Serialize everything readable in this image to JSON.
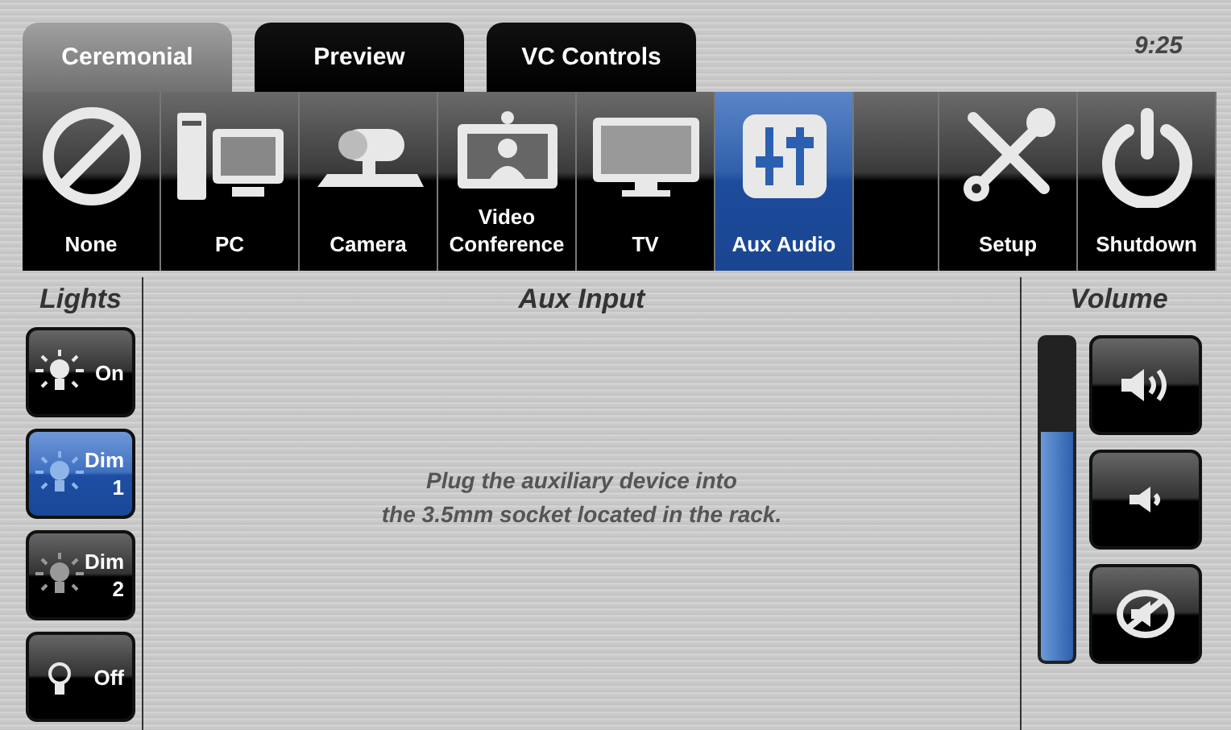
{
  "tabs": [
    {
      "label": "Ceremonial",
      "selected": true
    },
    {
      "label": "Preview",
      "selected": false
    },
    {
      "label": "VC Controls",
      "selected": false
    }
  ],
  "clock": "9:25",
  "sources": [
    {
      "kind": "none",
      "label": "None",
      "selected": false
    },
    {
      "kind": "pc",
      "label": "PC",
      "selected": false
    },
    {
      "kind": "camera",
      "label": "Camera",
      "selected": false
    },
    {
      "kind": "vc",
      "label": "Video Conference",
      "selected": false
    },
    {
      "kind": "tv",
      "label": "TV",
      "selected": false
    },
    {
      "kind": "aux",
      "label": "Aux Audio",
      "selected": true
    }
  ],
  "system": [
    {
      "kind": "setup",
      "label": "Setup"
    },
    {
      "kind": "power",
      "label": "Shutdown"
    }
  ],
  "lights": {
    "title": "Lights",
    "buttons": [
      {
        "kind": "on",
        "label": "On",
        "selected": false
      },
      {
        "kind": "dim",
        "label": "Dim",
        "sub": "1",
        "selected": true
      },
      {
        "kind": "dim",
        "label": "Dim",
        "sub": "2",
        "selected": false
      },
      {
        "kind": "off",
        "label": "Off",
        "selected": false
      }
    ]
  },
  "content": {
    "title": "Aux Input",
    "message": [
      "Plug the auxiliary device into",
      "the 3.5mm socket located in the rack."
    ]
  },
  "volume": {
    "title": "Volume",
    "level": 0.71,
    "buttons": [
      {
        "kind": "up"
      },
      {
        "kind": "down"
      },
      {
        "kind": "mute"
      }
    ]
  }
}
